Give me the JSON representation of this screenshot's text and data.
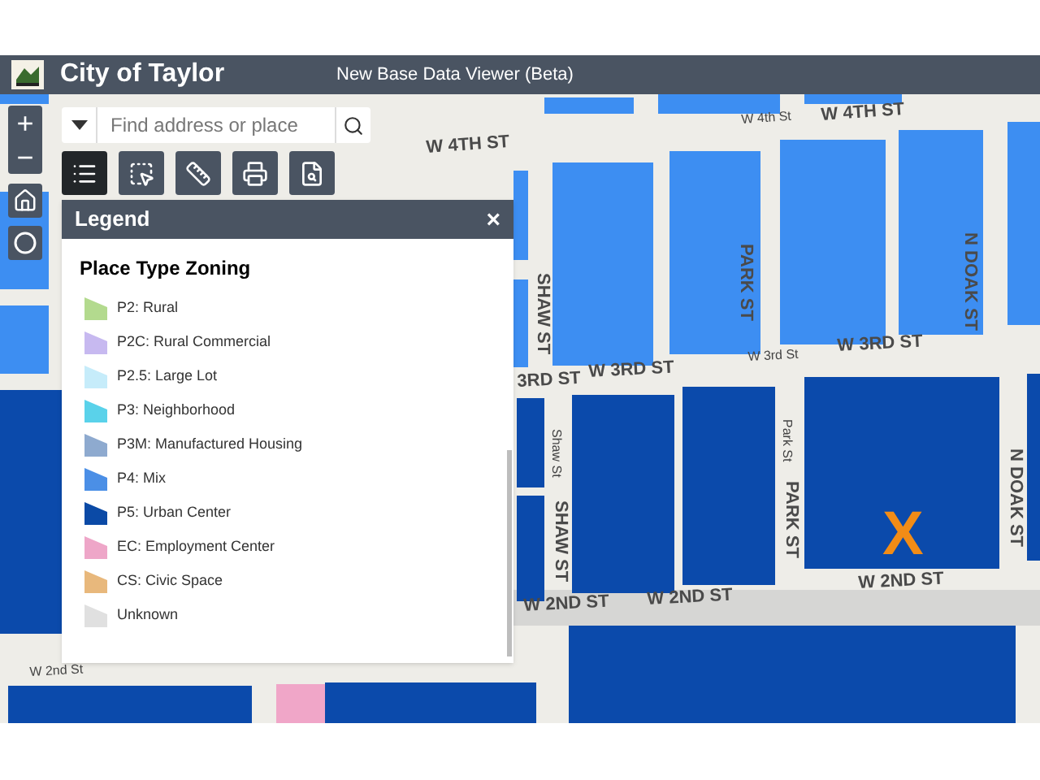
{
  "header": {
    "title": "City of Taylor",
    "subtitle": "New Base Data Viewer (Beta)"
  },
  "map_controls": {
    "zoom_in": "+",
    "zoom_out": "−"
  },
  "search": {
    "placeholder": "Find address or place"
  },
  "toolbar": [
    {
      "kind": "legend",
      "selected": true
    },
    {
      "kind": "select",
      "selected": false
    },
    {
      "kind": "measure",
      "selected": false
    },
    {
      "kind": "print",
      "selected": false
    },
    {
      "kind": "query",
      "selected": false
    }
  ],
  "legend": {
    "title": "Legend",
    "close": "×",
    "heading": "Place Type Zoning",
    "items": [
      {
        "label": "P2: Rural",
        "color": "#b3da8e"
      },
      {
        "label": "P2C: Rural Commercial",
        "color": "#c7b9f0"
      },
      {
        "label": "P2.5: Large Lot",
        "color": "#c6ecfa"
      },
      {
        "label": "P3: Neighborhood",
        "color": "#5ad2ea"
      },
      {
        "label": "P3M: Manufactured Housing",
        "color": "#8eaacf"
      },
      {
        "label": "P4: Mix",
        "color": "#4b8fe6"
      },
      {
        "label": "P5: Urban Center",
        "color": "#0b4aa6"
      },
      {
        "label": "EC: Employment Center",
        "color": "#eea6c8"
      },
      {
        "label": "CS: Civic Space",
        "color": "#e8b87c"
      },
      {
        "label": "Unknown",
        "color": "#e0e0e0"
      }
    ]
  },
  "map_labels": [
    {
      "text": "W 4TH ST",
      "kind": "major"
    },
    {
      "text": "W 4th St",
      "kind": "minor"
    },
    {
      "text": "W 4TH ST",
      "kind": "major"
    },
    {
      "text": "SHAW ST",
      "kind": "major"
    },
    {
      "text": "PARK ST",
      "kind": "major"
    },
    {
      "text": "N DOAK ST",
      "kind": "major"
    },
    {
      "text": "3RD ST",
      "kind": "major"
    },
    {
      "text": "W 3RD ST",
      "kind": "major"
    },
    {
      "text": "W 3rd St",
      "kind": "minor"
    },
    {
      "text": "W 3RD ST",
      "kind": "major"
    },
    {
      "text": "Shaw St",
      "kind": "minor"
    },
    {
      "text": "SHAW ST",
      "kind": "major"
    },
    {
      "text": "Park St",
      "kind": "minor"
    },
    {
      "text": "PARK ST",
      "kind": "major"
    },
    {
      "text": "N DOAK ST",
      "kind": "major"
    },
    {
      "text": "W 2ND ST",
      "kind": "major"
    },
    {
      "text": "W 2ND ST",
      "kind": "major"
    },
    {
      "text": "W 2ND ST",
      "kind": "major"
    },
    {
      "text": "W 2nd St",
      "kind": "minor"
    }
  ],
  "marker": {
    "text": "X"
  }
}
